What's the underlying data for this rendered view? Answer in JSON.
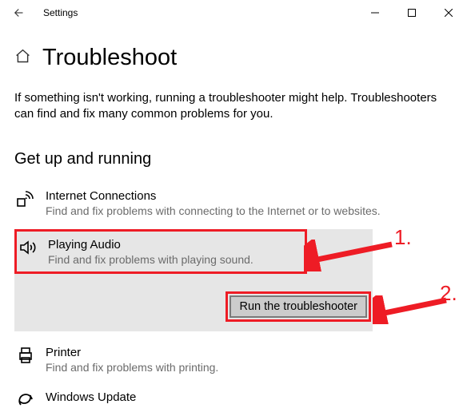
{
  "titlebar": {
    "title": "Settings"
  },
  "page_title": "Troubleshoot",
  "intro": "If something isn't working, running a troubleshooter might help. Troubleshooters can find and fix many common problems for you.",
  "section_title": "Get up and running",
  "items": {
    "internet": {
      "name": "Internet Connections",
      "desc": "Find and fix problems with connecting to the Internet or to websites."
    },
    "audio": {
      "name": "Playing Audio",
      "desc": "Find and fix problems with playing sound."
    },
    "printer": {
      "name": "Printer",
      "desc": "Find and fix problems with printing."
    },
    "update": {
      "name": "Windows Update"
    }
  },
  "run_button": "Run the troubleshooter",
  "annotations": {
    "one": "1.",
    "two": "2."
  }
}
